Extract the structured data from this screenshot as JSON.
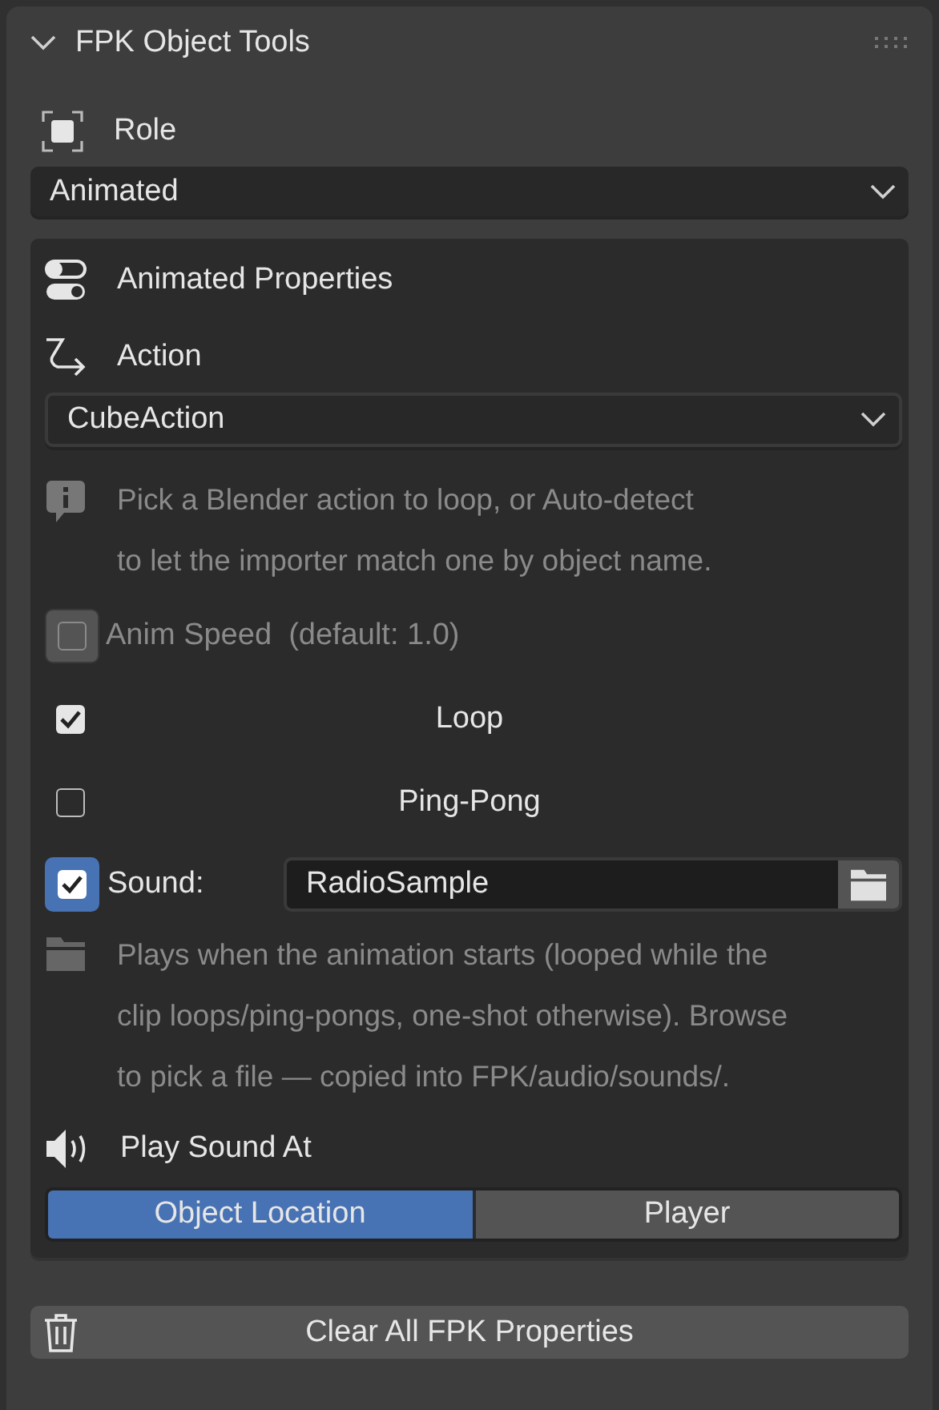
{
  "panel": {
    "title": "FPK Object Tools",
    "expanded": true
  },
  "role": {
    "label": "Role",
    "value": "Animated"
  },
  "animated_properties": {
    "title": "Animated Properties",
    "action": {
      "label": "Action",
      "value": "CubeAction"
    },
    "action_hint": [
      "Pick a Blender action to loop, or Auto-detect",
      "to let the importer match one by object name."
    ],
    "options": [
      {
        "kind": "inline",
        "label": "Anim Speed  (default: 1.0)",
        "checked": false,
        "disabled": true
      },
      {
        "kind": "centered",
        "label": "Loop",
        "checked": true,
        "disabled": false
      },
      {
        "kind": "centered",
        "label": "Ping-Pong",
        "checked": false,
        "disabled": false
      }
    ],
    "sound": {
      "label": "Sound:",
      "checked": true,
      "value": "RadioSample"
    },
    "sound_hint": [
      "Plays when the animation starts (looped while the",
      "clip loops/ping-pongs, one-shot otherwise). Browse",
      "to pick a file — copied into FPK/audio/sounds/."
    ],
    "play_at": {
      "label": "Play Sound At",
      "options": [
        {
          "label": "Object Location",
          "selected": true
        },
        {
          "label": "Player",
          "selected": false
        }
      ]
    }
  },
  "clear_button": "Clear All FPK Properties"
}
